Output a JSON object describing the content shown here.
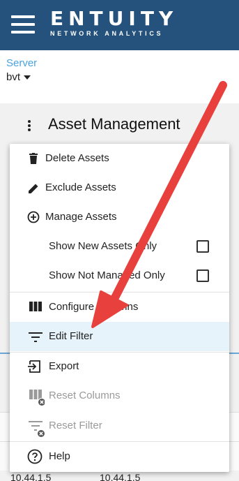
{
  "brand": {
    "name": "ENTUITY",
    "tagline": "NETWORK ANALYTICS"
  },
  "server": {
    "label": "Server",
    "value": "bvt"
  },
  "page": {
    "title": "Asset Management"
  },
  "menu": {
    "items": [
      {
        "label": "Delete Assets",
        "icon": "trash-icon"
      },
      {
        "label": "Exclude Assets",
        "icon": "pencil-icon"
      },
      {
        "label": "Manage Assets",
        "icon": "plus-circle-icon"
      },
      {
        "label": "Show New Assets Only",
        "checked": false
      },
      {
        "label": "Show Not Managed Only",
        "checked": false
      },
      {
        "label": "Configure Columns",
        "icon": "columns-icon"
      },
      {
        "label": "Edit Filter",
        "icon": "filter-icon",
        "highlighted": true
      },
      {
        "label": "Export",
        "icon": "export-icon"
      },
      {
        "label": "Reset Columns",
        "icon": "reset-columns-icon",
        "disabled": true
      },
      {
        "label": "Reset Filter",
        "icon": "reset-filter-icon",
        "disabled": true
      },
      {
        "label": "Help",
        "icon": "help-icon"
      }
    ]
  },
  "table": {
    "row": [
      "10.44.1.5",
      "10.44.1.5"
    ]
  },
  "colors": {
    "header": "#24527c",
    "accent": "#4aa3df",
    "highlight": "#e6f3fb",
    "arrow": "#e8413d"
  }
}
